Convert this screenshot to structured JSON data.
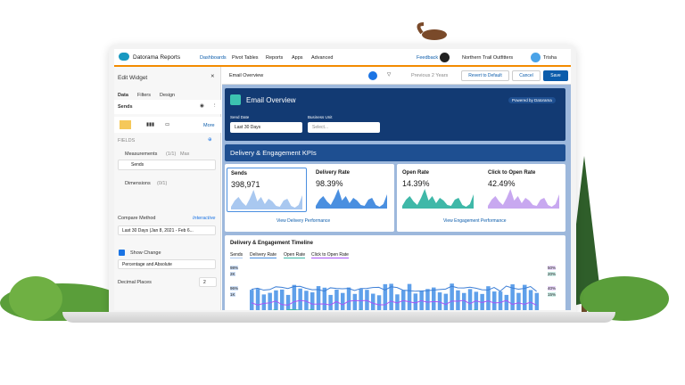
{
  "nav": {
    "app": "Datorama Reports",
    "tabs": [
      "Dashboards",
      "Pivot Tables",
      "Reports",
      "Apps",
      "Advanced"
    ],
    "feedback": "Feedback",
    "org": "Northern Trail Outfitters",
    "user": "Trisha"
  },
  "sidebar": {
    "title": "Edit Widget",
    "tabs": [
      "Data",
      "Filters",
      "Design"
    ],
    "widget": "Sends",
    "more": "More",
    "fields_label": "FIELDS",
    "measurements": "Measurements",
    "measurements_count": "(1/1)",
    "max": "Max",
    "measure_item": "Sends",
    "dimensions": "Dimensions",
    "dimensions_count": "(0/1)",
    "compare_label": "Compare Method",
    "compare_mode": "Interactive",
    "compare_value": "Last 30 Days (Jan 8, 2021 - Feb 6...",
    "show_change": "Show Change",
    "show_change_checked": true,
    "change_format": "Percentage and Absolute",
    "decimal_label": "Decimal Places",
    "decimal_value": "2"
  },
  "toolbar": {
    "title": "Email Overview",
    "date_range": "Previous 2 Years",
    "revert": "Revert to Default",
    "cancel": "Cancel",
    "save": "Save"
  },
  "header": {
    "title": "Email Overview",
    "badge": "Powered by Datorama",
    "send_date_label": "Send Date",
    "send_date_value": "Last 30 Days",
    "bu_label": "Business Unit",
    "bu_placeholder": "Select..."
  },
  "kpi_section": {
    "title": "Delivery & Engagement KPIs",
    "kpis": [
      {
        "label": "Sends",
        "value": "398,971",
        "color": "#a9c8f0"
      },
      {
        "label": "Delivery Rate",
        "value": "98.39%",
        "color": "#4a8fe0"
      },
      {
        "label": "Open Rate",
        "value": "14.39%",
        "color": "#3fb8a8"
      },
      {
        "label": "Click to Open Rate",
        "value": "42.49%",
        "color": "#c8a8f0"
      }
    ],
    "link_delivery": "View Delivery Performance",
    "link_engagement": "View Engagement Performance"
  },
  "timeline": {
    "title": "Delivery & Engagement Timeline",
    "legend": [
      "Sends",
      "Delivery Rate",
      "Open Rate",
      "Click to Open Rate"
    ],
    "left_ticks": [
      "98%",
      "2K",
      "96%",
      "1K"
    ],
    "right_ticks": [
      "50%",
      "20%",
      "40%",
      "15%"
    ]
  }
}
